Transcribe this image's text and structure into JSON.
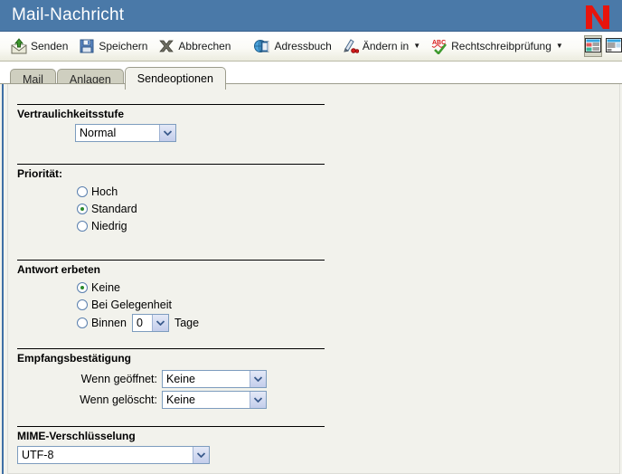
{
  "window": {
    "title": "Mail-Nachricht",
    "logo_icon": "novell-n-logo",
    "title_bar_color": "#4a79a8",
    "logo_color": "#e8140c"
  },
  "toolbar": {
    "buttons": [
      {
        "label": "Senden",
        "icon": "send-envelope-icon",
        "has_caret": false
      },
      {
        "label": "Speichern",
        "icon": "floppy-disk-icon",
        "has_caret": false
      },
      {
        "label": "Abbrechen",
        "icon": "cancel-x-icon",
        "has_caret": false
      },
      {
        "label": "Adressbuch",
        "icon": "address-book-icon",
        "has_caret": false
      },
      {
        "label": "Ändern in",
        "icon": "change-to-icon",
        "has_caret": true
      },
      {
        "label": "Rechtschreibprüfung",
        "icon": "spellcheck-abc-icon",
        "has_caret": true
      }
    ],
    "caret_glyph": "▼",
    "view_buttons": [
      {
        "icon": "view-layout-left-icon",
        "pressed": true
      },
      {
        "icon": "view-layout-top-icon",
        "pressed": false
      }
    ]
  },
  "tabs": [
    {
      "label": "Mail",
      "active": false
    },
    {
      "label": "Anlagen",
      "active": false
    },
    {
      "label": "Sendeoptionen",
      "active": true
    }
  ],
  "form": {
    "confidentiality": {
      "title": "Vertraulichkeitsstufe",
      "value": "Normal"
    },
    "priority": {
      "title": "Priorität:",
      "options": [
        {
          "label": "Hoch",
          "selected": false
        },
        {
          "label": "Standard",
          "selected": true
        },
        {
          "label": "Niedrig",
          "selected": false
        }
      ]
    },
    "reply_requested": {
      "title": "Antwort erbeten",
      "options": [
        {
          "label": "Keine",
          "selected": true
        },
        {
          "label": "Bei Gelegenheit",
          "selected": false
        },
        {
          "label": "Binnen",
          "selected": false
        }
      ],
      "days_value": "0",
      "days_suffix": "Tage"
    },
    "return_notification": {
      "title": "Empfangsbestätigung",
      "rows": [
        {
          "label": "Wenn geöffnet:",
          "value": "Keine"
        },
        {
          "label": "Wenn gelöscht:",
          "value": "Keine"
        }
      ]
    },
    "mime_encoding": {
      "title": "MIME-Verschlüsselung",
      "value": "UTF-8"
    }
  }
}
